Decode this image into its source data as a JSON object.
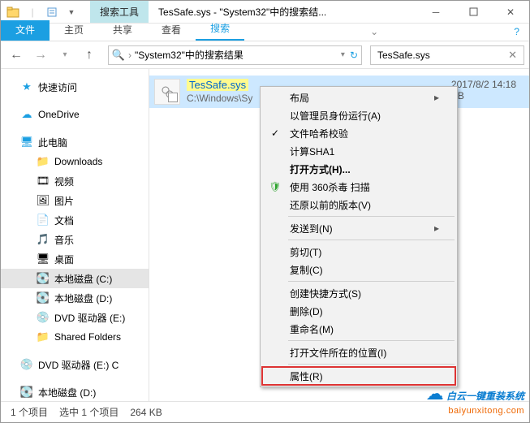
{
  "titlebar": {
    "search_tools": "搜索工具",
    "title": "TesSafe.sys - \"System32\"中的搜索结..."
  },
  "ribbon": {
    "file": "文件",
    "home": "主页",
    "share": "共享",
    "view": "查看",
    "search": "搜索"
  },
  "address": {
    "icon": "🔍",
    "chevron": "›",
    "text": "\"System32\"中的搜索结果"
  },
  "search": {
    "value": "TesSafe.sys"
  },
  "sidebar": {
    "items": [
      {
        "label": "快速访问",
        "icon": "★"
      },
      {
        "label": "OneDrive",
        "icon": "☁"
      },
      {
        "label": "此电脑",
        "icon": "🖥"
      },
      {
        "label": "Downloads",
        "icon": "📁"
      },
      {
        "label": "视频",
        "icon": "🎞"
      },
      {
        "label": "图片",
        "icon": "🖼"
      },
      {
        "label": "文档",
        "icon": "📄"
      },
      {
        "label": "音乐",
        "icon": "🎵"
      },
      {
        "label": "桌面",
        "icon": "🖥"
      },
      {
        "label": "本地磁盘 (C:)",
        "icon": "💽"
      },
      {
        "label": "本地磁盘 (D:)",
        "icon": "💽"
      },
      {
        "label": "DVD 驱动器 (E:)",
        "icon": "💿"
      },
      {
        "label": "Shared Folders",
        "icon": "📁"
      },
      {
        "label": "DVD 驱动器 (E:) C",
        "icon": "💿"
      },
      {
        "label": "本地磁盘 (D:)",
        "icon": "💽"
      }
    ]
  },
  "file": {
    "name": "TesSafe.sys",
    "path": "C:\\Windows\\Sy",
    "date": "2017/8/2 14:18",
    "size_suffix": "KB"
  },
  "context_menu": {
    "items": [
      {
        "label": "布局",
        "arrow": true
      },
      {
        "label": "以管理员身份运行(A)"
      },
      {
        "label": "文件哈希校验",
        "icon": "✓"
      },
      {
        "label": "计算SHA1"
      },
      {
        "label": "打开方式(H)...",
        "bold": true
      },
      {
        "label": "使用 360杀毒 扫描",
        "icon": "🛡"
      },
      {
        "label": "还原以前的版本(V)"
      },
      {
        "sep": true
      },
      {
        "label": "发送到(N)",
        "arrow": true
      },
      {
        "sep": true
      },
      {
        "label": "剪切(T)"
      },
      {
        "label": "复制(C)"
      },
      {
        "sep": true
      },
      {
        "label": "创建快捷方式(S)"
      },
      {
        "label": "删除(D)"
      },
      {
        "label": "重命名(M)"
      },
      {
        "sep": true
      },
      {
        "label": "打开文件所在的位置(I)"
      },
      {
        "sep": true
      },
      {
        "label": "属性(R)",
        "highlight": true
      }
    ]
  },
  "statusbar": {
    "items_count": "1 个项目",
    "selection": "选中 1 个项目",
    "size": "264 KB"
  },
  "watermark": {
    "cn": "白云一键重装系统",
    "en": "baiyunxitong.com"
  }
}
